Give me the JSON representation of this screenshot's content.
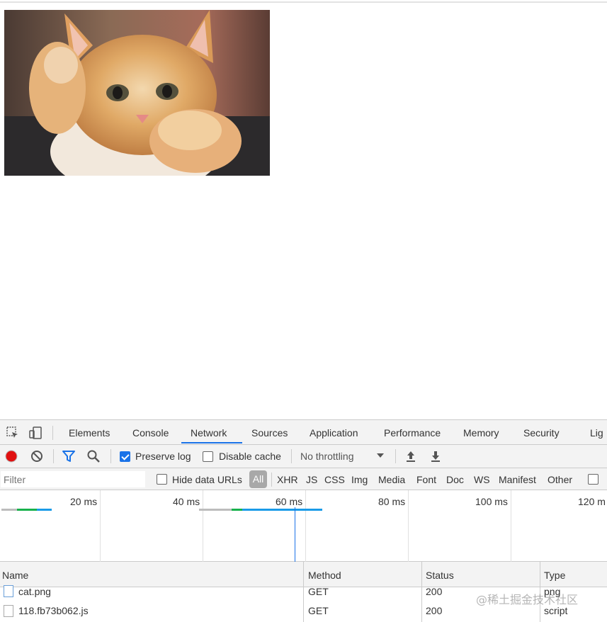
{
  "page": {
    "image_alt": "orange tabby kitten raising paws"
  },
  "devtools": {
    "tabs": [
      "Elements",
      "Console",
      "Network",
      "Sources",
      "Application",
      "Performance",
      "Memory",
      "Security",
      "Lig"
    ],
    "active_tab": "Network",
    "toolbar": {
      "preserve_log_label": "Preserve log",
      "preserve_log_checked": true,
      "disable_cache_label": "Disable cache",
      "disable_cache_checked": false,
      "throttling_value": "No throttling"
    },
    "filter": {
      "placeholder": "Filter",
      "hide_data_urls_label": "Hide data URLs",
      "types": [
        "All",
        "XHR",
        "JS",
        "CSS",
        "Img",
        "Media",
        "Font",
        "Doc",
        "WS",
        "Manifest",
        "Other"
      ],
      "selected_type": "All"
    },
    "timeline": {
      "ticks": [
        "20 ms",
        "40 ms",
        "60 ms",
        "80 ms",
        "100 ms",
        "120 m"
      ]
    },
    "table": {
      "headers": {
        "name": "Name",
        "method": "Method",
        "status": "Status",
        "type": "Type"
      },
      "rows": [
        {
          "name": "cat.png",
          "method": "GET",
          "status": "200",
          "type": "png"
        },
        {
          "name": "118.fb73b062.js",
          "method": "GET",
          "status": "200",
          "type": "script"
        }
      ]
    }
  },
  "watermark": "@稀土掘金技术社区",
  "colors": {
    "accent": "#1a73e8",
    "record": "#e01010",
    "panel_bg": "#f3f3f3",
    "timeline_green": "#18b14c",
    "timeline_blue": "#1a9be8"
  }
}
